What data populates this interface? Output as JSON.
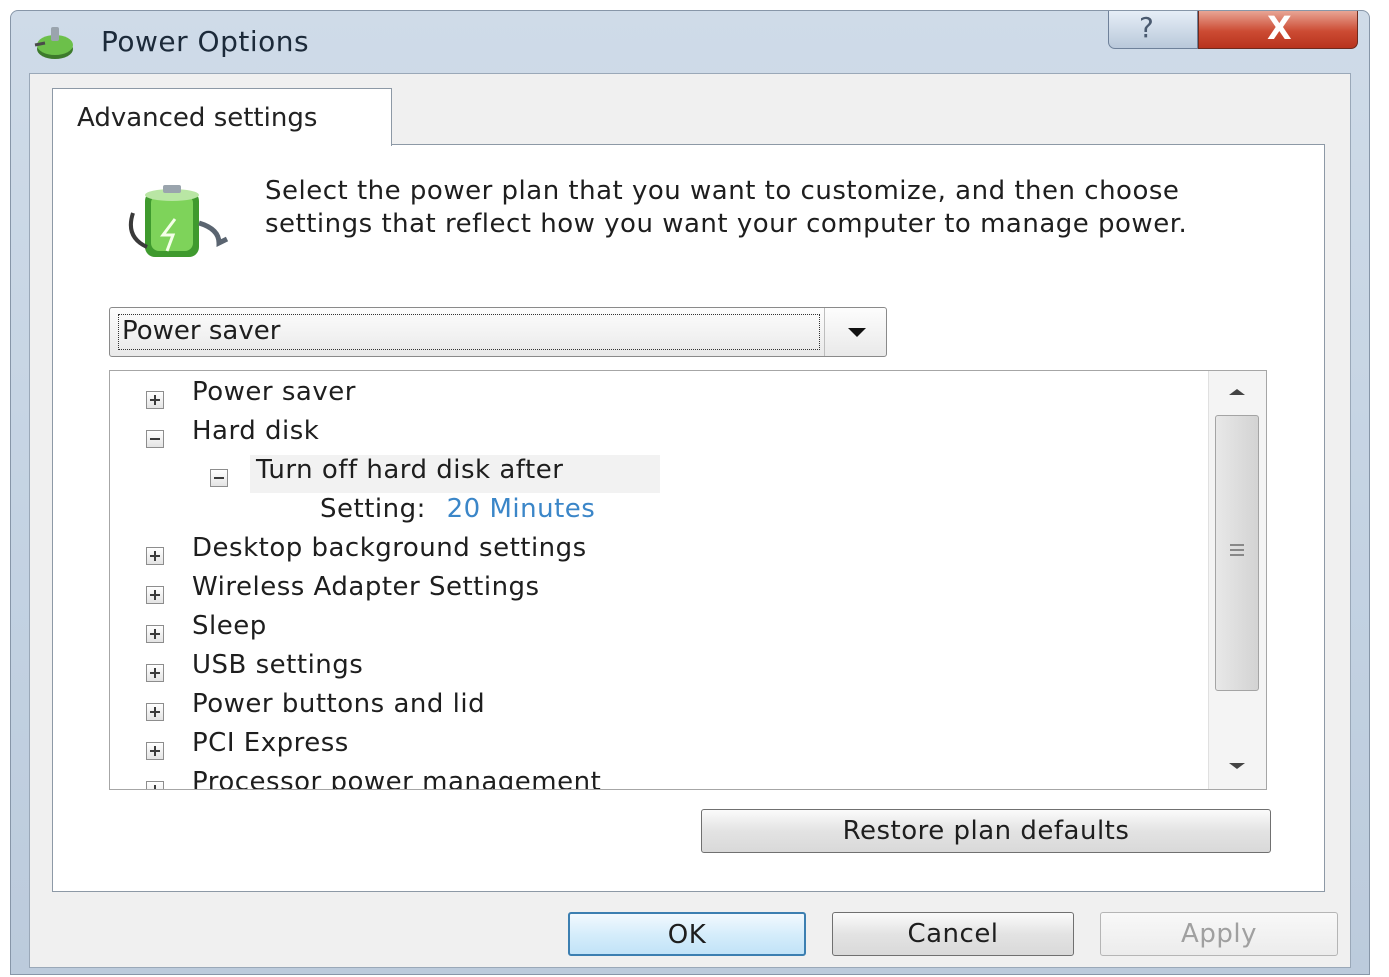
{
  "window": {
    "title": "Power Options",
    "help_symbol": "?",
    "close_symbol": "X"
  },
  "tab": {
    "label": "Advanced settings"
  },
  "description": "Select the power plan that you want to customize, and then choose settings that reflect how you want your computer to manage power.",
  "plan_select": {
    "value": "Power saver"
  },
  "tree": {
    "items": [
      {
        "label": "Power saver",
        "state": "collapsed"
      },
      {
        "label": "Hard disk",
        "state": "expanded"
      },
      {
        "label": "Turn off hard disk after",
        "state": "expanded"
      },
      {
        "label": "Setting:",
        "value": "20 Minutes"
      },
      {
        "label": "Desktop background settings",
        "state": "collapsed"
      },
      {
        "label": "Wireless Adapter Settings",
        "state": "collapsed"
      },
      {
        "label": "Sleep",
        "state": "collapsed"
      },
      {
        "label": "USB settings",
        "state": "collapsed"
      },
      {
        "label": "Power buttons and lid",
        "state": "collapsed"
      },
      {
        "label": "PCI Express",
        "state": "collapsed"
      },
      {
        "label": "Processor power management",
        "state": "collapsed"
      }
    ]
  },
  "buttons": {
    "restore": "Restore plan defaults",
    "ok": "OK",
    "cancel": "Cancel",
    "apply": "Apply"
  },
  "colors": {
    "setting_value": "#3b86c8",
    "close_button": "#cc4b33"
  }
}
